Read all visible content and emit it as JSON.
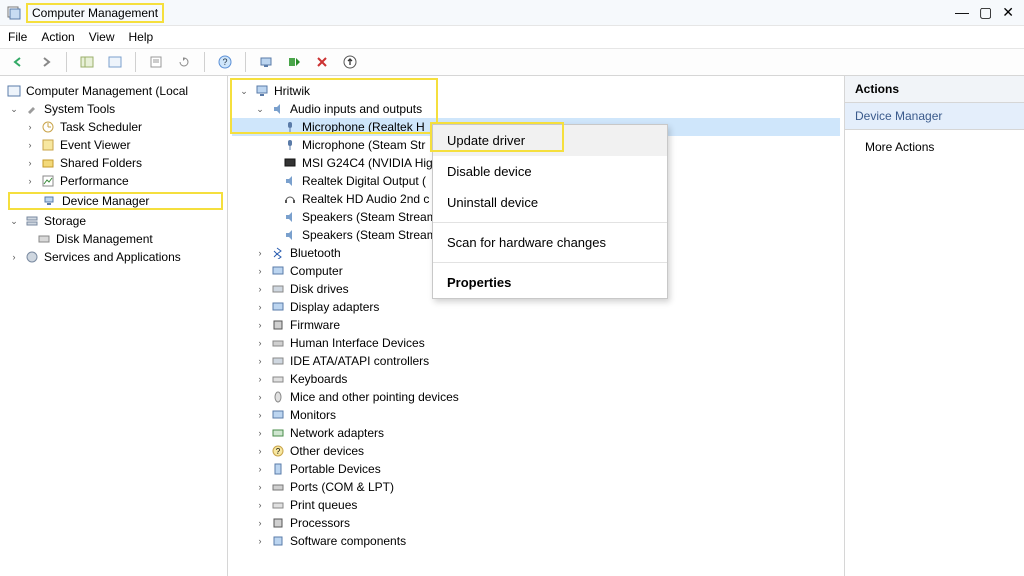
{
  "title": "Computer Management",
  "menu": {
    "file": "File",
    "action": "Action",
    "view": "View",
    "help": "Help"
  },
  "left_tree": {
    "root": "Computer Management (Local",
    "system_tools": "System Tools",
    "items": [
      "Task Scheduler",
      "Event Viewer",
      "Shared Folders",
      "Performance",
      "Device Manager"
    ],
    "storage": "Storage",
    "disk_mgmt": "Disk Management",
    "services": "Services and Applications"
  },
  "center": {
    "root": "Hritwik",
    "audio_cat": "Audio inputs and outputs",
    "audio_children": [
      "Microphone (Realtek H",
      "Microphone (Steam Str",
      "MSI G24C4 (NVIDIA Hig",
      "Realtek Digital Output (",
      "Realtek HD Audio 2nd c",
      "Speakers (Steam Stream",
      "Speakers (Steam Stream"
    ],
    "categories": [
      "Bluetooth",
      "Computer",
      "Disk drives",
      "Display adapters",
      "Firmware",
      "Human Interface Devices",
      "IDE ATA/ATAPI controllers",
      "Keyboards",
      "Mice and other pointing devices",
      "Monitors",
      "Network adapters",
      "Other devices",
      "Portable Devices",
      "Ports (COM & LPT)",
      "Print queues",
      "Processors",
      "Software components"
    ]
  },
  "context_menu": {
    "update": "Update driver",
    "disable": "Disable device",
    "uninstall": "Uninstall device",
    "scan": "Scan for hardware changes",
    "properties": "Properties"
  },
  "actions": {
    "header": "Actions",
    "subject": "Device Manager",
    "more": "More Actions"
  }
}
